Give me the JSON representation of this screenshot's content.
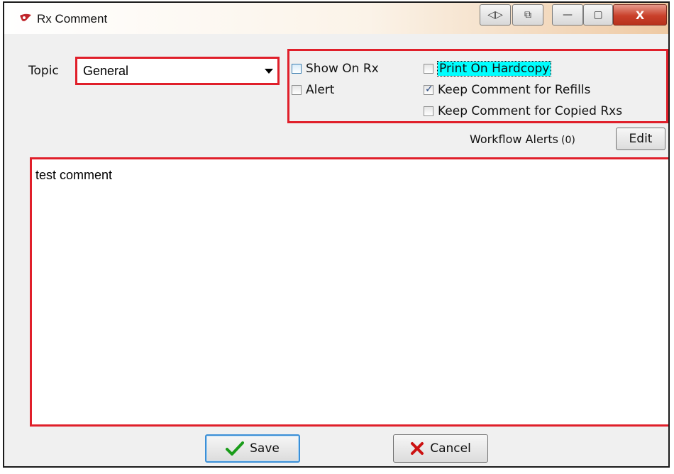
{
  "window": {
    "title": "Rx Comment",
    "titlebar_buttons": [
      "◁▷",
      "⧉",
      "—",
      "▢",
      "X"
    ]
  },
  "topic": {
    "label": "Topic",
    "value": "General"
  },
  "options": {
    "show_on_rx": {
      "label": "Show On Rx",
      "checked": false
    },
    "alert": {
      "label": "Alert",
      "checked": false
    },
    "print_on_hardcopy": {
      "label": "Print On Hardcopy",
      "checked": false
    },
    "keep_for_refills": {
      "label": "Keep Comment for Refills",
      "checked": true
    },
    "keep_for_copied": {
      "label": "Keep Comment for Copied Rxs",
      "checked": false
    }
  },
  "workflow": {
    "label": "Workflow Alerts",
    "count": "(0)",
    "edit_label": "Edit"
  },
  "comment": {
    "text": "test comment"
  },
  "footer": {
    "save_label": "Save",
    "cancel_label": "Cancel"
  },
  "colors": {
    "highlight_box": "#e01f2a",
    "focus_highlight": "#00ffff",
    "save_check": "#1a9c1a",
    "cancel_x": "#cc1111"
  }
}
